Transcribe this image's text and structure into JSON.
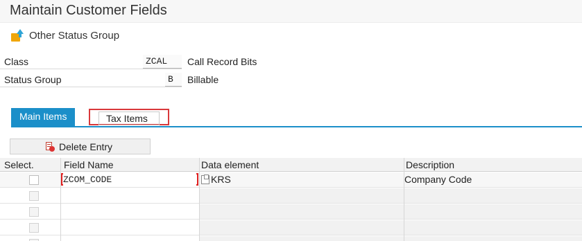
{
  "window": {
    "title": "Maintain Customer Fields"
  },
  "toolbar": {
    "other_status_group": "Other Status Group",
    "icon": "status-group-icon"
  },
  "form": {
    "class": {
      "label": "Class",
      "value": "ZCAL",
      "description": "Call Record Bits"
    },
    "status_group": {
      "label": "Status Group",
      "value": "B",
      "description": "Billable"
    }
  },
  "tabs": [
    {
      "label": "Main Items",
      "active": true
    },
    {
      "label": "Tax Items",
      "active": false
    }
  ],
  "table_toolbar": {
    "delete_entry": "Delete Entry"
  },
  "table": {
    "columns": [
      "Select.",
      "Field Name",
      "Data element",
      "Description"
    ],
    "rows": [
      {
        "field_name": "ZCOM_CODE",
        "data_element": "KRS",
        "description": "Company Code"
      }
    ]
  },
  "colors": {
    "accent": "#1b8fc9",
    "highlight_box": "#d9383a"
  }
}
